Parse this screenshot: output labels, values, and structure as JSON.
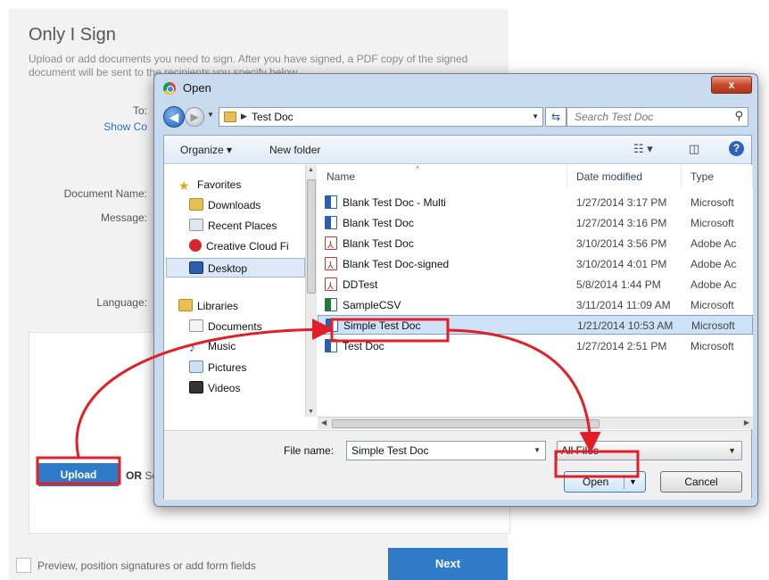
{
  "page": {
    "title": "Only I Sign",
    "description": "Upload or add documents you need to sign. After you have signed, a PDF copy of the signed document will be sent to the recipients you specify below.",
    "to_label": "To:",
    "show_link": "Show Co",
    "doc_name_label": "Document Name:",
    "message_label": "Message:",
    "language_label": "Language:",
    "upload_label": "Upload",
    "or_label": "OR",
    "or_rest": "Se",
    "preview_label": "Preview, position signatures or add form fields",
    "next_label": "Next"
  },
  "dialog": {
    "title": "Open",
    "close": "x",
    "breadcrumb": "Test Doc",
    "search_placeholder": "Search Test Doc",
    "toolbar": {
      "organize": "Organize ▾",
      "new_folder": "New folder"
    },
    "nav": {
      "favorites": "Favorites",
      "downloads": "Downloads",
      "recent_places": "Recent Places",
      "creative_cloud": "Creative Cloud Fi",
      "desktop": "Desktop",
      "libraries": "Libraries",
      "documents": "Documents",
      "music": "Music",
      "pictures": "Pictures",
      "videos": "Videos"
    },
    "columns": {
      "name": "Name",
      "date": "Date modified",
      "type": "Type"
    },
    "files": [
      {
        "name": "Blank Test Doc - Multi",
        "date": "1/27/2014 3:17 PM",
        "type": "Microsoft",
        "icon": "word-icon"
      },
      {
        "name": "Blank Test Doc",
        "date": "1/27/2014 3:16 PM",
        "type": "Microsoft",
        "icon": "word-icon"
      },
      {
        "name": "Blank Test Doc",
        "date": "3/10/2014 3:56 PM",
        "type": "Adobe Ac",
        "icon": "pdf-icon"
      },
      {
        "name": "Blank Test Doc-signed",
        "date": "3/10/2014 4:01 PM",
        "type": "Adobe Ac",
        "icon": "pdf-icon"
      },
      {
        "name": "DDTest",
        "date": "5/8/2014 1:44 PM",
        "type": "Adobe Ac",
        "icon": "pdf-icon"
      },
      {
        "name": "SampleCSV",
        "date": "3/11/2014 11:09 AM",
        "type": "Microsoft",
        "icon": "excel-icon"
      },
      {
        "name": "Simple Test Doc",
        "date": "1/21/2014 10:53 AM",
        "type": "Microsoft",
        "icon": "word-icon"
      },
      {
        "name": "Test Doc",
        "date": "1/27/2014 2:51 PM",
        "type": "Microsoft",
        "icon": "word-icon"
      }
    ],
    "selected_file": "Simple Test Doc",
    "file_name_label": "File name:",
    "file_name_value": "Simple Test Doc",
    "file_type": "All Files",
    "open_label": "Open",
    "cancel_label": "Cancel"
  },
  "colors": {
    "accent_blue": "#2f7bc8",
    "annotation_red": "#e41e26",
    "selection": "#cde2f8"
  }
}
